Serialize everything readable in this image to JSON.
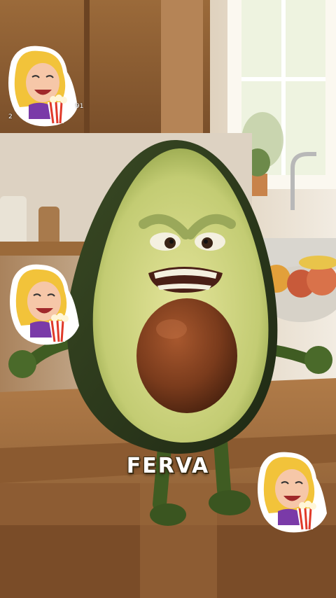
{
  "caption": {
    "text": "FERVA"
  },
  "stickers": [
    {
      "icon": "woman-with-popcorn-sticker",
      "count_left": "2",
      "count_right": "91"
    },
    {
      "icon": "woman-with-popcorn-sticker"
    },
    {
      "icon": "woman-with-popcorn-sticker"
    }
  ],
  "colors": {
    "avocado_flesh": "#c8cf7a",
    "avocado_skin": "#2f3a1e",
    "pit": "#7a3b1c",
    "countertop": "#9a6a3d",
    "wall": "#e8dccb"
  }
}
